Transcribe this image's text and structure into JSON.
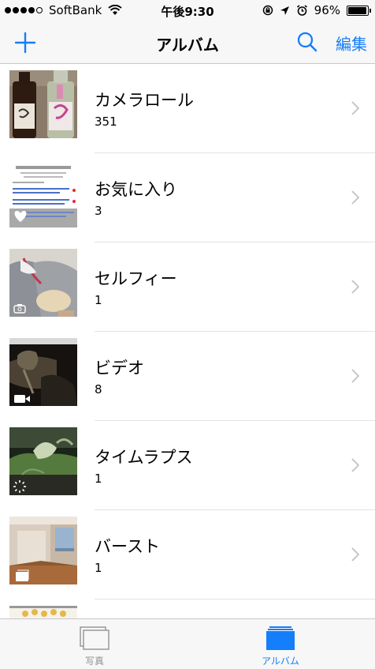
{
  "status_bar": {
    "carrier": "SoftBank",
    "time": "午後9:30",
    "battery": "96%",
    "battery_level": 0.96,
    "signal_bars": 4
  },
  "nav": {
    "title": "アルバム",
    "edit": "編集"
  },
  "albums": [
    {
      "title": "カメラロール",
      "count": "351"
    },
    {
      "title": "お気に入り",
      "count": "3"
    },
    {
      "title": "セルフィー",
      "count": "1"
    },
    {
      "title": "ビデオ",
      "count": "8"
    },
    {
      "title": "タイムラプス",
      "count": "1"
    },
    {
      "title": "バースト",
      "count": "1"
    }
  ],
  "tabs": {
    "photos": "写真",
    "albums": "アルバム"
  },
  "colors": {
    "accent": "#157efb",
    "inactive": "#929292"
  }
}
